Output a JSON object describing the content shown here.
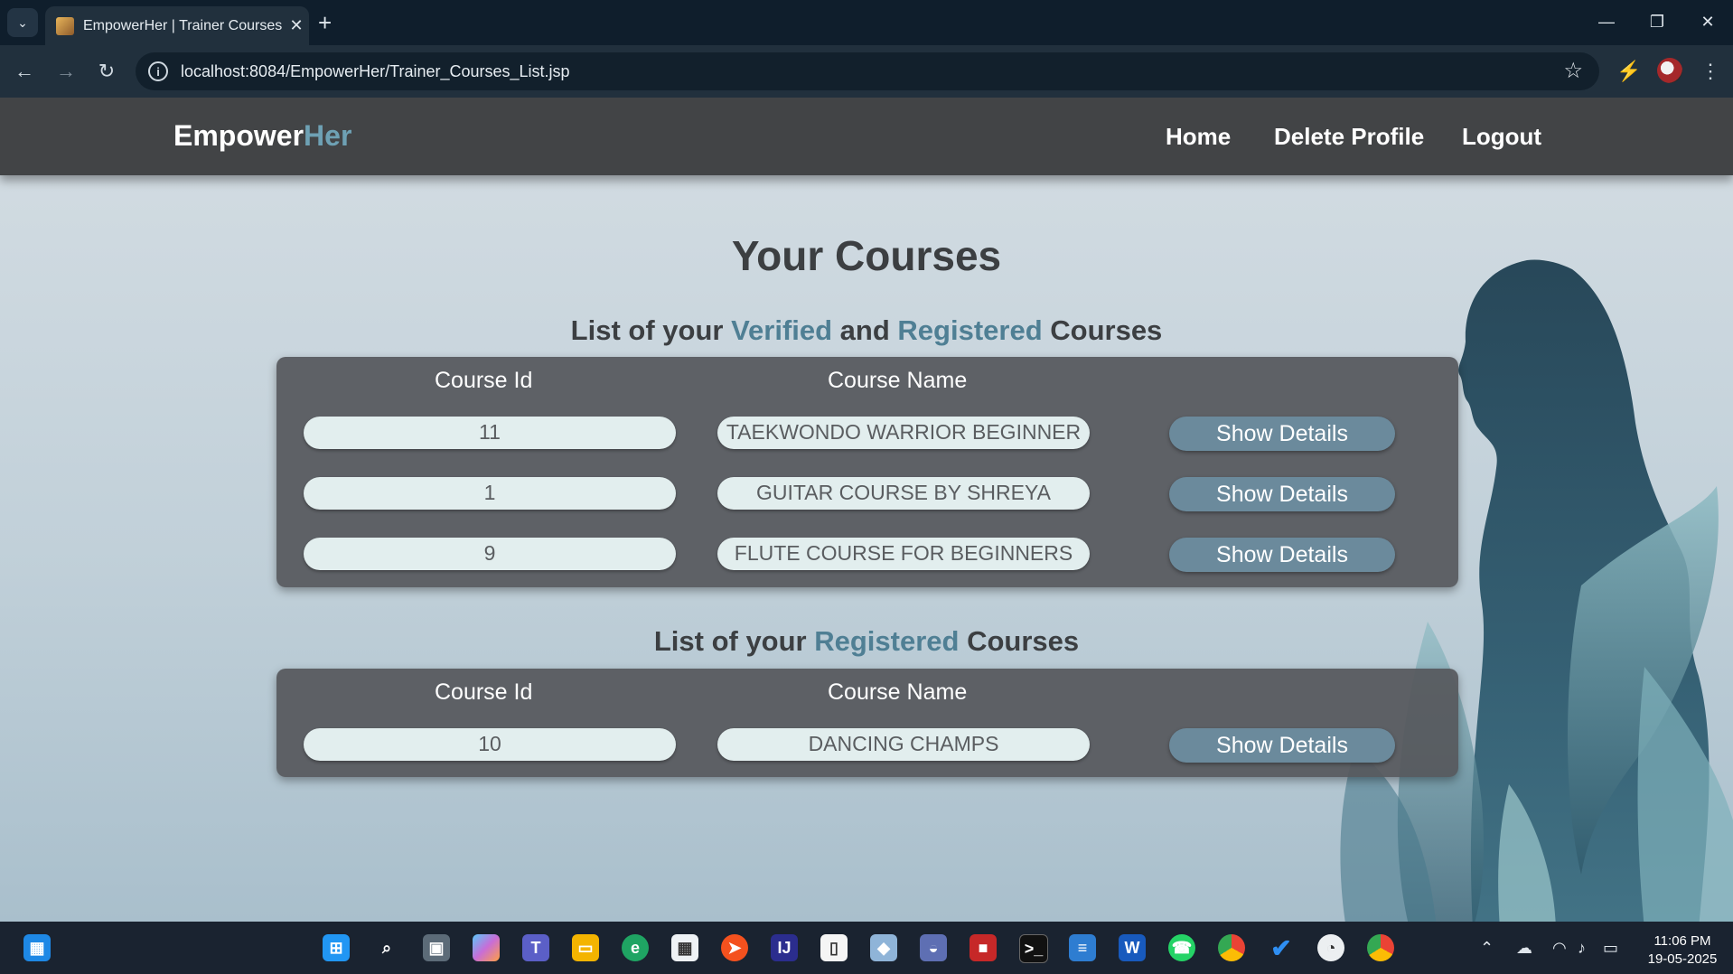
{
  "browser": {
    "tab_title": "EmpowerHer | Trainer Courses",
    "url": "localhost:8084/EmpowerHer/Trainer_Courses_List.jsp"
  },
  "site": {
    "brand_main": "Empower",
    "brand_accent": "Her",
    "nav": [
      "Home",
      "Delete Profile",
      "Logout"
    ]
  },
  "page": {
    "title": "Your Courses",
    "section1": {
      "prefix": "List of your ",
      "hl1": "Verified",
      "mid": " and ",
      "hl2": "Registered",
      "suffix": " Courses"
    },
    "section2": {
      "prefix": "List of your ",
      "hl": "Registered",
      "suffix": " Courses"
    },
    "table_headers": {
      "id": "Course Id",
      "name": "Course Name"
    },
    "verified_courses": [
      {
        "id": "11",
        "name": "TAEKWONDO WARRIOR BEGINNER",
        "action": "Show Details"
      },
      {
        "id": "1",
        "name": "GUITAR COURSE BY SHREYA",
        "action": "Show Details"
      },
      {
        "id": "9",
        "name": "FLUTE COURSE FOR BEGINNERS",
        "action": "Show Details"
      }
    ],
    "registered_courses": [
      {
        "id": "10",
        "name": "DANCING CHAMPS",
        "action": "Show Details"
      }
    ]
  },
  "taskbar": {
    "time": "11:06 PM",
    "date": "19-05-2025"
  },
  "colors": {
    "navbar": "#424446",
    "accent": "#6ea1b4",
    "panel": "#56585c",
    "button": "#6b8a9c",
    "pill": "#e2eeee"
  }
}
